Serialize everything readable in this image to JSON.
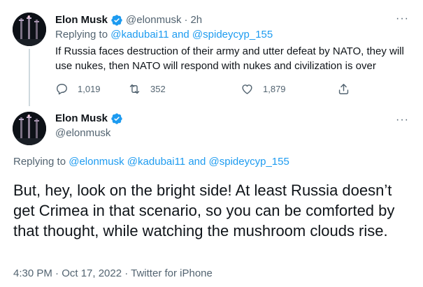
{
  "reply_tweet": {
    "author_name": "Elon Musk",
    "handle": "@elonmusk",
    "separator": "·",
    "time": "2h",
    "replying_prefix": "Replying to",
    "replying_to": "@kadubai11 and @spideycyp_155",
    "text": "If Russia faces destruction of their army and utter defeat by NATO, they will use nukes, then NATO will respond with nukes and civilization is over",
    "reply_count": "1,019",
    "retweet_count": "352",
    "like_count": "1,879",
    "more": "···"
  },
  "main_tweet": {
    "author_name": "Elon Musk",
    "handle": "@elonmusk",
    "replying_prefix": "Replying to",
    "replying_to": "@elonmusk @kadubai11 and @spideycyp_155",
    "text": "But, hey, look on the bright side! At least Russia doesn’t get Crimea in that scenario, so you can be comforted by that thought, while watching the mushroom clouds rise.",
    "timestamp": "4:30 PM · Oct 17, 2022 · Twitter for iPhone",
    "more": "···"
  },
  "colors": {
    "accent": "#1d9bf0",
    "text": "#0f1419",
    "secondary": "#536471",
    "divider": "#cfd9de"
  },
  "icons": [
    "avatar-image",
    "verified-badge-icon",
    "reply-icon",
    "retweet-icon",
    "like-icon",
    "share-icon",
    "more-icon"
  ]
}
